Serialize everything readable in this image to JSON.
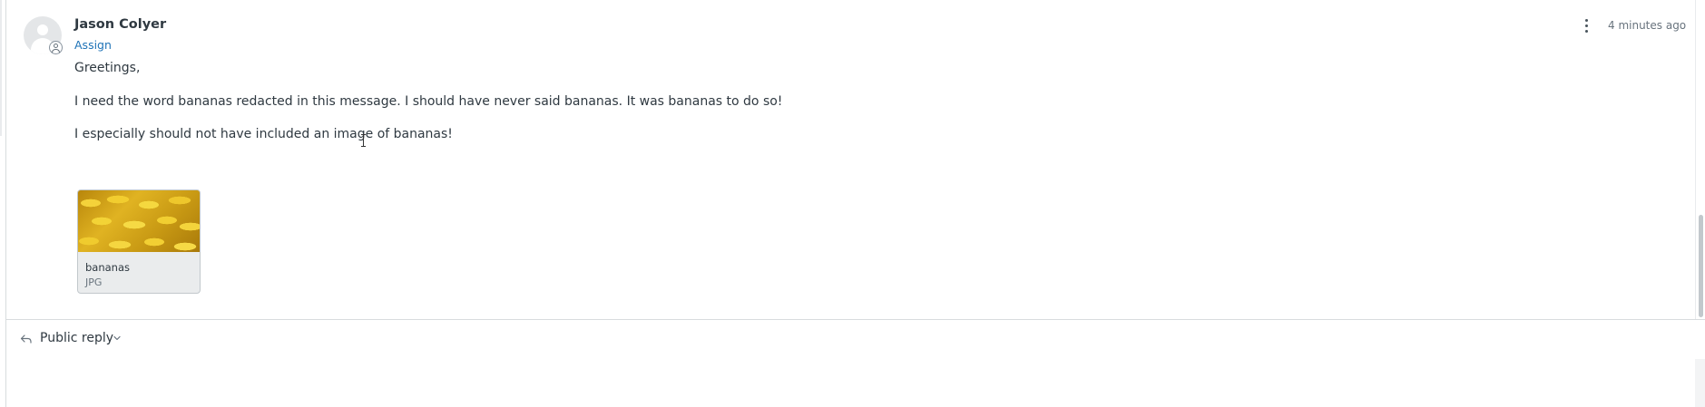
{
  "comment": {
    "author": "Jason Colyer",
    "assign_label": "Assign",
    "timestamp": "4 minutes ago",
    "paragraphs": [
      "Greetings,",
      "I need the word bananas redacted in this message. I should have never said bananas. It was bananas to do so!",
      "I especially should not have included an image of bananas!"
    ],
    "attachment": {
      "name": "bananas",
      "type": "JPG"
    }
  },
  "composer": {
    "reply_mode": "Public reply"
  },
  "icons": {
    "menu": "kebab-menu-icon",
    "reply": "reply-arrow-icon",
    "dropdown": "chevron-down-icon",
    "avatar_badge": "agent-user-icon"
  },
  "colors": {
    "link": "#1f73b7",
    "text": "#2f3941",
    "muted": "#68737d"
  }
}
